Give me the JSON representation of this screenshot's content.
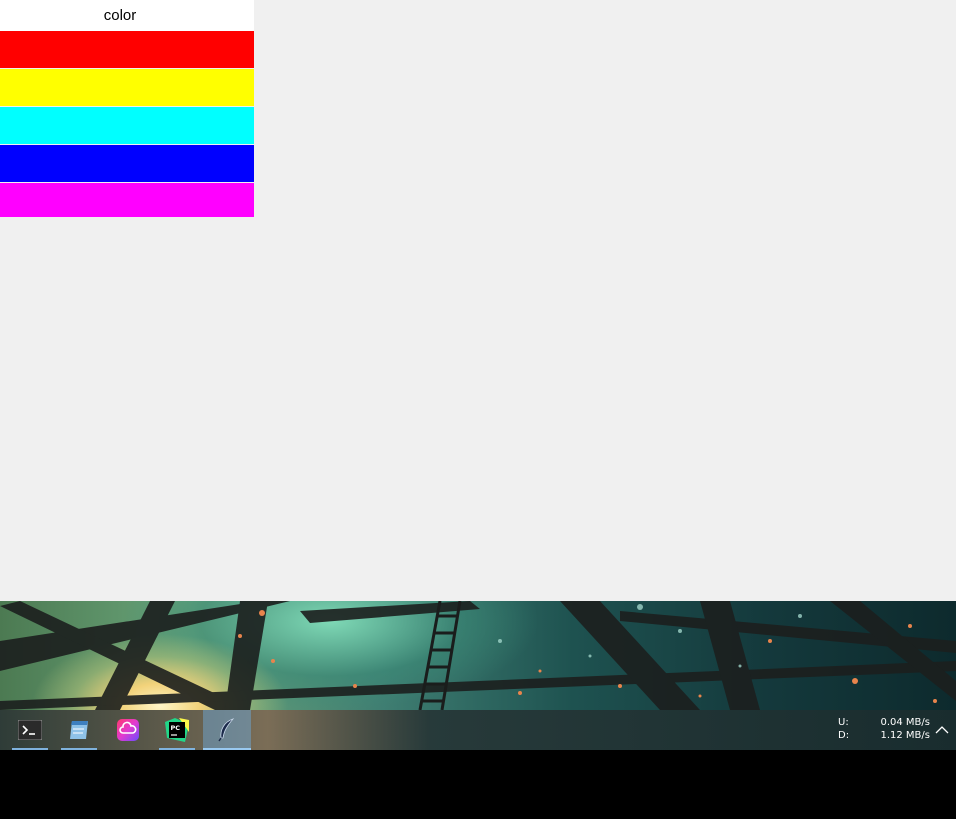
{
  "app": {
    "column_header": "color",
    "swatches": [
      {
        "name": "red",
        "color": "#ff0000"
      },
      {
        "name": "yellow",
        "color": "#ffff00"
      },
      {
        "name": "cyan",
        "color": "#00ffff"
      },
      {
        "name": "blue",
        "color": "#0000ff"
      },
      {
        "name": "magenta",
        "color": "#ff00ff"
      }
    ]
  },
  "taskbar": {
    "apps": [
      {
        "icon": "terminal-icon"
      },
      {
        "icon": "notepad-icon"
      },
      {
        "icon": "creative-cloud-icon"
      },
      {
        "icon": "pycharm-icon"
      },
      {
        "icon": "feather-icon",
        "active": true
      }
    ],
    "network": {
      "upload_label": "U:",
      "upload_value": "0.04 MB/s",
      "download_label": "D:",
      "download_value": "1.12 MB/s"
    },
    "tray_icon": "chevron-up-icon"
  }
}
